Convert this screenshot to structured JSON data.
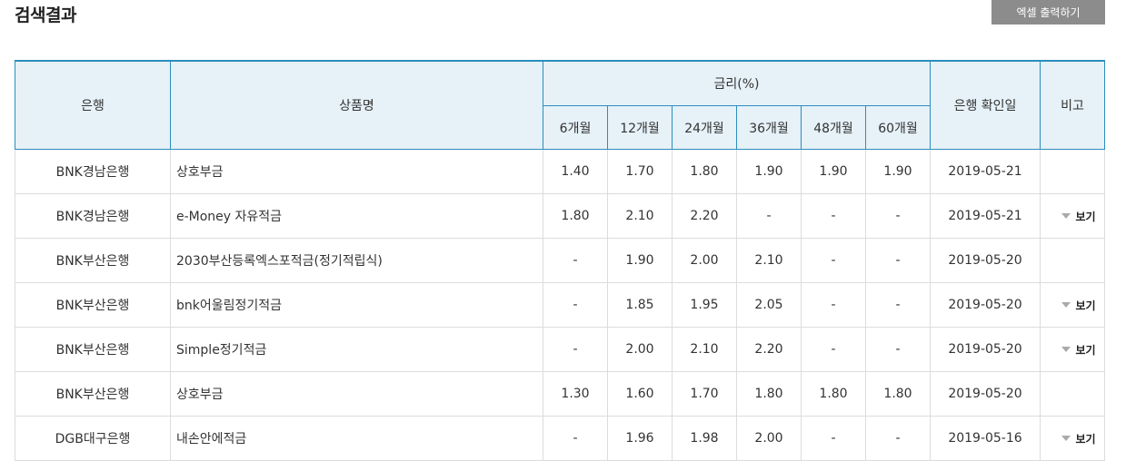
{
  "page_title": "검색결과",
  "excel_button": "엑셀 출력하기",
  "headers": {
    "bank": "은행",
    "product": "상품명",
    "rate_group": "금리(%)",
    "terms": [
      "6개월",
      "12개월",
      "24개월",
      "36개월",
      "48개월",
      "60개월"
    ],
    "confirm_date": "은행 확인일",
    "note": "비고"
  },
  "rows": [
    {
      "bank": "BNK경남은행",
      "product": "상호부금",
      "rates": [
        "1.40",
        "1.70",
        "1.80",
        "1.90",
        "1.90",
        "1.90"
      ],
      "date": "2019-05-21",
      "note": ""
    },
    {
      "bank": "BNK경남은행",
      "product": "e-Money 자유적금",
      "rates": [
        "1.80",
        "2.10",
        "2.20",
        "-",
        "-",
        "-"
      ],
      "date": "2019-05-21",
      "note": "보기"
    },
    {
      "bank": "BNK부산은행",
      "product": "2030부산등록엑스포적금(정기적립식)",
      "rates": [
        "-",
        "1.90",
        "2.00",
        "2.10",
        "-",
        "-"
      ],
      "date": "2019-05-20",
      "note": ""
    },
    {
      "bank": "BNK부산은행",
      "product": "bnk어울림정기적금",
      "rates": [
        "-",
        "1.85",
        "1.95",
        "2.05",
        "-",
        "-"
      ],
      "date": "2019-05-20",
      "note": "보기"
    },
    {
      "bank": "BNK부산은행",
      "product": "Simple정기적금",
      "rates": [
        "-",
        "2.00",
        "2.10",
        "2.20",
        "-",
        "-"
      ],
      "date": "2019-05-20",
      "note": "보기"
    },
    {
      "bank": "BNK부산은행",
      "product": "상호부금",
      "rates": [
        "1.30",
        "1.60",
        "1.70",
        "1.80",
        "1.80",
        "1.80"
      ],
      "date": "2019-05-20",
      "note": ""
    },
    {
      "bank": "DGB대구은행",
      "product": "내손안에적금",
      "rates": [
        "-",
        "1.96",
        "1.98",
        "2.00",
        "-",
        "-"
      ],
      "date": "2019-05-16",
      "note": "보기"
    }
  ]
}
